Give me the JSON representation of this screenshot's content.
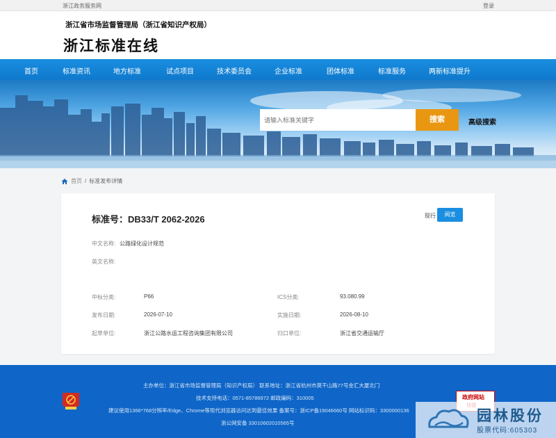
{
  "topbar": {
    "left": "浙江政务服务网",
    "right": "登录"
  },
  "header": {
    "org": "浙江省市场监督管理局（浙江省知识产权局）",
    "site_title": "浙江标准在线"
  },
  "nav": {
    "items": [
      "首页",
      "标准资讯",
      "地方标准",
      "试点项目",
      "技术委员会",
      "企业标准",
      "团体标准",
      "标准服务",
      "两新标准提升"
    ]
  },
  "search": {
    "placeholder": "请输入标准关键字",
    "button": "搜索",
    "advanced": "高级搜索"
  },
  "breadcrumb": {
    "home": "首页",
    "sep": "/",
    "current": "标准发布详情"
  },
  "detail": {
    "std_no": "标准号：DB33/T 2062-2026",
    "status": "现行",
    "read_button": "阅览",
    "cn_name_label": "中文名称:",
    "cn_name": "公路绿化设计规范",
    "en_name_label": "英文名称:",
    "en_name": "",
    "ccs_label": "中标分类:",
    "ccs": "P66",
    "ics_label": "ICS分类:",
    "ics": "93.080.99",
    "pub_label": "发布日期:",
    "pub_date": "2026-07-10",
    "impl_label": "实施日期:",
    "impl_date": "2026-08-10",
    "drafter_label": "起草单位:",
    "drafter": "浙江公路水运工程咨询集团有限公司",
    "owner_label": "归口单位:",
    "owner": "浙江省交通运输厅"
  },
  "footer": {
    "line1": "主办单位：浙江省市场监督管理局（知识产权局）    联系地址：浙江省杭州市莫干山路77号金汇大厦北门",
    "line2": "技术支持电话：0571-85786972    邮政编码：310005",
    "line3": "建议使用1366*768分辨率/Edge、Chrome等现代浏览器访问达到最佳效果    备案号：浙ICP备19046660号 网站标识码：3300000136",
    "line4": "浙公网安备 33010602010565号",
    "find_error_1": "政府网站",
    "find_error_2": "找错"
  },
  "watermark": {
    "name": "园林股份",
    "code": "股票代码:605303"
  },
  "colors": {
    "nav": "#1a8ee0",
    "accent_orange": "#e99712",
    "footer": "#0f66c8",
    "button_blue": "#1a8ee0"
  }
}
